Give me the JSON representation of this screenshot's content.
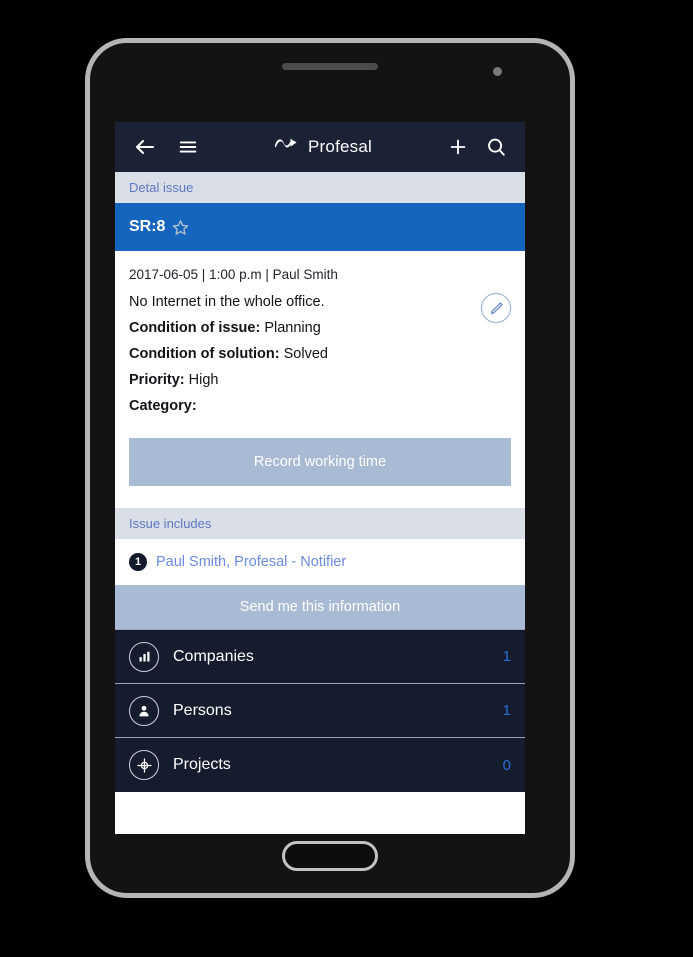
{
  "appbar": {
    "back_icon": "back-arrow-icon",
    "menu_icon": "hamburger-menu-icon",
    "logo_icon": "profesal-logo-icon",
    "brand": "Profesal",
    "add_icon": "plus-icon",
    "search_icon": "search-icon"
  },
  "breadcrumb": {
    "label": "Detal issue"
  },
  "issue": {
    "code": "SR:8",
    "favorite_icon": "star-outline-icon",
    "meta": "2017-06-05 | 1:00 p.m | Paul Smith",
    "description": "No Internet in the whole office.",
    "edit_icon": "pencil-edit-icon",
    "fields": [
      {
        "label": "Condition of issue:",
        "value": "Planning"
      },
      {
        "label": "Condition of solution:",
        "value": "Solved"
      },
      {
        "label": "Priority:",
        "value": "High"
      },
      {
        "label": "Category:",
        "value": ""
      }
    ],
    "record_button": "Record working time"
  },
  "includes": {
    "header": "Issue includes",
    "badge_count": "1",
    "person_link": "Paul Smith, Profesal - Notifier",
    "send_button": "Send me this information"
  },
  "related": {
    "rows": [
      {
        "icon": "bar-chart-icon",
        "label": "Companies",
        "count": "1"
      },
      {
        "icon": "person-icon",
        "label": "Persons",
        "count": "1"
      },
      {
        "icon": "target-crosshair-icon",
        "label": "Projects",
        "count": "0"
      }
    ]
  },
  "colors": {
    "appbar": "#1b2236",
    "section_bar": "#d9dee7",
    "section_text": "#5e78c4",
    "sr_bar": "#1565bf",
    "button": "#a8bad4",
    "dark_list": "#151c2d",
    "count": "#2a6ed6",
    "link": "#6b8ae0"
  }
}
